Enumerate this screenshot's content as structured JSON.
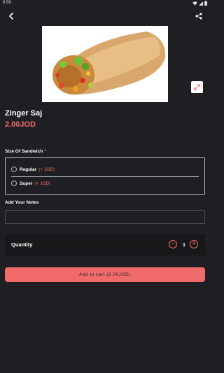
{
  "status_bar": {
    "time": "9:59"
  },
  "icons": {
    "back": "back-arrow-icon",
    "share": "share-icon",
    "expand": "expand-icon",
    "wifi": "wifi-icon",
    "signal": "signal-icon",
    "battery": "battery-icon"
  },
  "product": {
    "name": "Zinger Saj",
    "price": "2.00JOD"
  },
  "size_section": {
    "label": "Size Of Sandwich",
    "required_mark": "*",
    "options": [
      {
        "label": "Regular",
        "extra": "(+ JOD)"
      },
      {
        "label": "Super",
        "extra": "(+ JOD)"
      }
    ]
  },
  "notes": {
    "label": "Add Your Notes",
    "value": "",
    "placeholder": ""
  },
  "quantity": {
    "label": "Quantity",
    "value": "1",
    "minus": "−",
    "plus": "+"
  },
  "cart": {
    "button_label": "Add to cart (2.00JOD)"
  },
  "colors": {
    "background": "#1f1f23",
    "accent": "#f26b6b",
    "panel": "#18181b"
  }
}
